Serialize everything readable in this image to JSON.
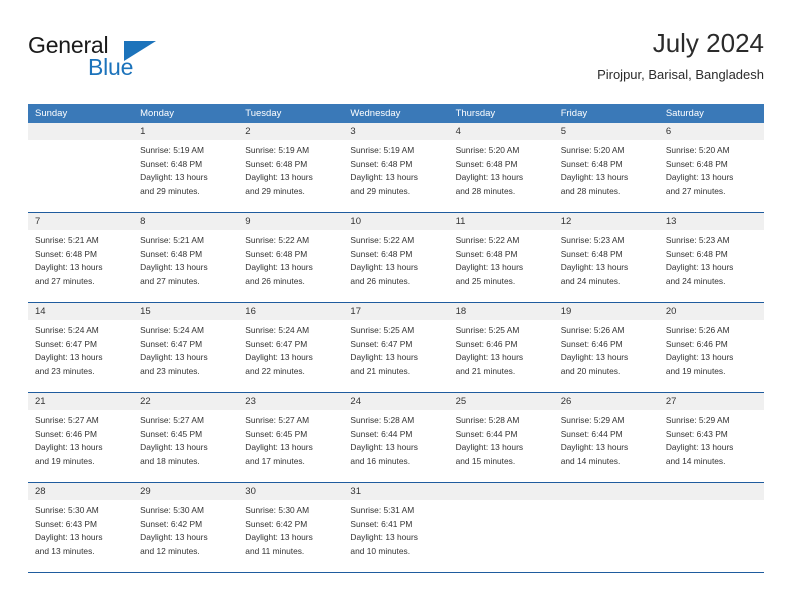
{
  "logo": {
    "word1": "General",
    "word2": "Blue",
    "triangle_color": "#1c73bb"
  },
  "header": {
    "title": "July 2024",
    "location": "Pirojpur, Barisal, Bangladesh"
  },
  "theme": {
    "header_blue": "#3a79b8",
    "rule_blue": "#1f5c9e",
    "daynum_band": "#f0f0f0",
    "text": "#333333"
  },
  "weekdays": [
    "Sunday",
    "Monday",
    "Tuesday",
    "Wednesday",
    "Thursday",
    "Friday",
    "Saturday"
  ],
  "weeks": [
    [
      {
        "day": "",
        "lines": []
      },
      {
        "day": "1",
        "lines": [
          "Sunrise: 5:19 AM",
          "Sunset: 6:48 PM",
          "Daylight: 13 hours",
          "and 29 minutes."
        ]
      },
      {
        "day": "2",
        "lines": [
          "Sunrise: 5:19 AM",
          "Sunset: 6:48 PM",
          "Daylight: 13 hours",
          "and 29 minutes."
        ]
      },
      {
        "day": "3",
        "lines": [
          "Sunrise: 5:19 AM",
          "Sunset: 6:48 PM",
          "Daylight: 13 hours",
          "and 29 minutes."
        ]
      },
      {
        "day": "4",
        "lines": [
          "Sunrise: 5:20 AM",
          "Sunset: 6:48 PM",
          "Daylight: 13 hours",
          "and 28 minutes."
        ]
      },
      {
        "day": "5",
        "lines": [
          "Sunrise: 5:20 AM",
          "Sunset: 6:48 PM",
          "Daylight: 13 hours",
          "and 28 minutes."
        ]
      },
      {
        "day": "6",
        "lines": [
          "Sunrise: 5:20 AM",
          "Sunset: 6:48 PM",
          "Daylight: 13 hours",
          "and 27 minutes."
        ]
      }
    ],
    [
      {
        "day": "7",
        "lines": [
          "Sunrise: 5:21 AM",
          "Sunset: 6:48 PM",
          "Daylight: 13 hours",
          "and 27 minutes."
        ]
      },
      {
        "day": "8",
        "lines": [
          "Sunrise: 5:21 AM",
          "Sunset: 6:48 PM",
          "Daylight: 13 hours",
          "and 27 minutes."
        ]
      },
      {
        "day": "9",
        "lines": [
          "Sunrise: 5:22 AM",
          "Sunset: 6:48 PM",
          "Daylight: 13 hours",
          "and 26 minutes."
        ]
      },
      {
        "day": "10",
        "lines": [
          "Sunrise: 5:22 AM",
          "Sunset: 6:48 PM",
          "Daylight: 13 hours",
          "and 26 minutes."
        ]
      },
      {
        "day": "11",
        "lines": [
          "Sunrise: 5:22 AM",
          "Sunset: 6:48 PM",
          "Daylight: 13 hours",
          "and 25 minutes."
        ]
      },
      {
        "day": "12",
        "lines": [
          "Sunrise: 5:23 AM",
          "Sunset: 6:48 PM",
          "Daylight: 13 hours",
          "and 24 minutes."
        ]
      },
      {
        "day": "13",
        "lines": [
          "Sunrise: 5:23 AM",
          "Sunset: 6:48 PM",
          "Daylight: 13 hours",
          "and 24 minutes."
        ]
      }
    ],
    [
      {
        "day": "14",
        "lines": [
          "Sunrise: 5:24 AM",
          "Sunset: 6:47 PM",
          "Daylight: 13 hours",
          "and 23 minutes."
        ]
      },
      {
        "day": "15",
        "lines": [
          "Sunrise: 5:24 AM",
          "Sunset: 6:47 PM",
          "Daylight: 13 hours",
          "and 23 minutes."
        ]
      },
      {
        "day": "16",
        "lines": [
          "Sunrise: 5:24 AM",
          "Sunset: 6:47 PM",
          "Daylight: 13 hours",
          "and 22 minutes."
        ]
      },
      {
        "day": "17",
        "lines": [
          "Sunrise: 5:25 AM",
          "Sunset: 6:47 PM",
          "Daylight: 13 hours",
          "and 21 minutes."
        ]
      },
      {
        "day": "18",
        "lines": [
          "Sunrise: 5:25 AM",
          "Sunset: 6:46 PM",
          "Daylight: 13 hours",
          "and 21 minutes."
        ]
      },
      {
        "day": "19",
        "lines": [
          "Sunrise: 5:26 AM",
          "Sunset: 6:46 PM",
          "Daylight: 13 hours",
          "and 20 minutes."
        ]
      },
      {
        "day": "20",
        "lines": [
          "Sunrise: 5:26 AM",
          "Sunset: 6:46 PM",
          "Daylight: 13 hours",
          "and 19 minutes."
        ]
      }
    ],
    [
      {
        "day": "21",
        "lines": [
          "Sunrise: 5:27 AM",
          "Sunset: 6:46 PM",
          "Daylight: 13 hours",
          "and 19 minutes."
        ]
      },
      {
        "day": "22",
        "lines": [
          "Sunrise: 5:27 AM",
          "Sunset: 6:45 PM",
          "Daylight: 13 hours",
          "and 18 minutes."
        ]
      },
      {
        "day": "23",
        "lines": [
          "Sunrise: 5:27 AM",
          "Sunset: 6:45 PM",
          "Daylight: 13 hours",
          "and 17 minutes."
        ]
      },
      {
        "day": "24",
        "lines": [
          "Sunrise: 5:28 AM",
          "Sunset: 6:44 PM",
          "Daylight: 13 hours",
          "and 16 minutes."
        ]
      },
      {
        "day": "25",
        "lines": [
          "Sunrise: 5:28 AM",
          "Sunset: 6:44 PM",
          "Daylight: 13 hours",
          "and 15 minutes."
        ]
      },
      {
        "day": "26",
        "lines": [
          "Sunrise: 5:29 AM",
          "Sunset: 6:44 PM",
          "Daylight: 13 hours",
          "and 14 minutes."
        ]
      },
      {
        "day": "27",
        "lines": [
          "Sunrise: 5:29 AM",
          "Sunset: 6:43 PM",
          "Daylight: 13 hours",
          "and 14 minutes."
        ]
      }
    ],
    [
      {
        "day": "28",
        "lines": [
          "Sunrise: 5:30 AM",
          "Sunset: 6:43 PM",
          "Daylight: 13 hours",
          "and 13 minutes."
        ]
      },
      {
        "day": "29",
        "lines": [
          "Sunrise: 5:30 AM",
          "Sunset: 6:42 PM",
          "Daylight: 13 hours",
          "and 12 minutes."
        ]
      },
      {
        "day": "30",
        "lines": [
          "Sunrise: 5:30 AM",
          "Sunset: 6:42 PM",
          "Daylight: 13 hours",
          "and 11 minutes."
        ]
      },
      {
        "day": "31",
        "lines": [
          "Sunrise: 5:31 AM",
          "Sunset: 6:41 PM",
          "Daylight: 13 hours",
          "and 10 minutes."
        ]
      },
      {
        "day": "",
        "lines": []
      },
      {
        "day": "",
        "lines": []
      },
      {
        "day": "",
        "lines": []
      }
    ]
  ]
}
